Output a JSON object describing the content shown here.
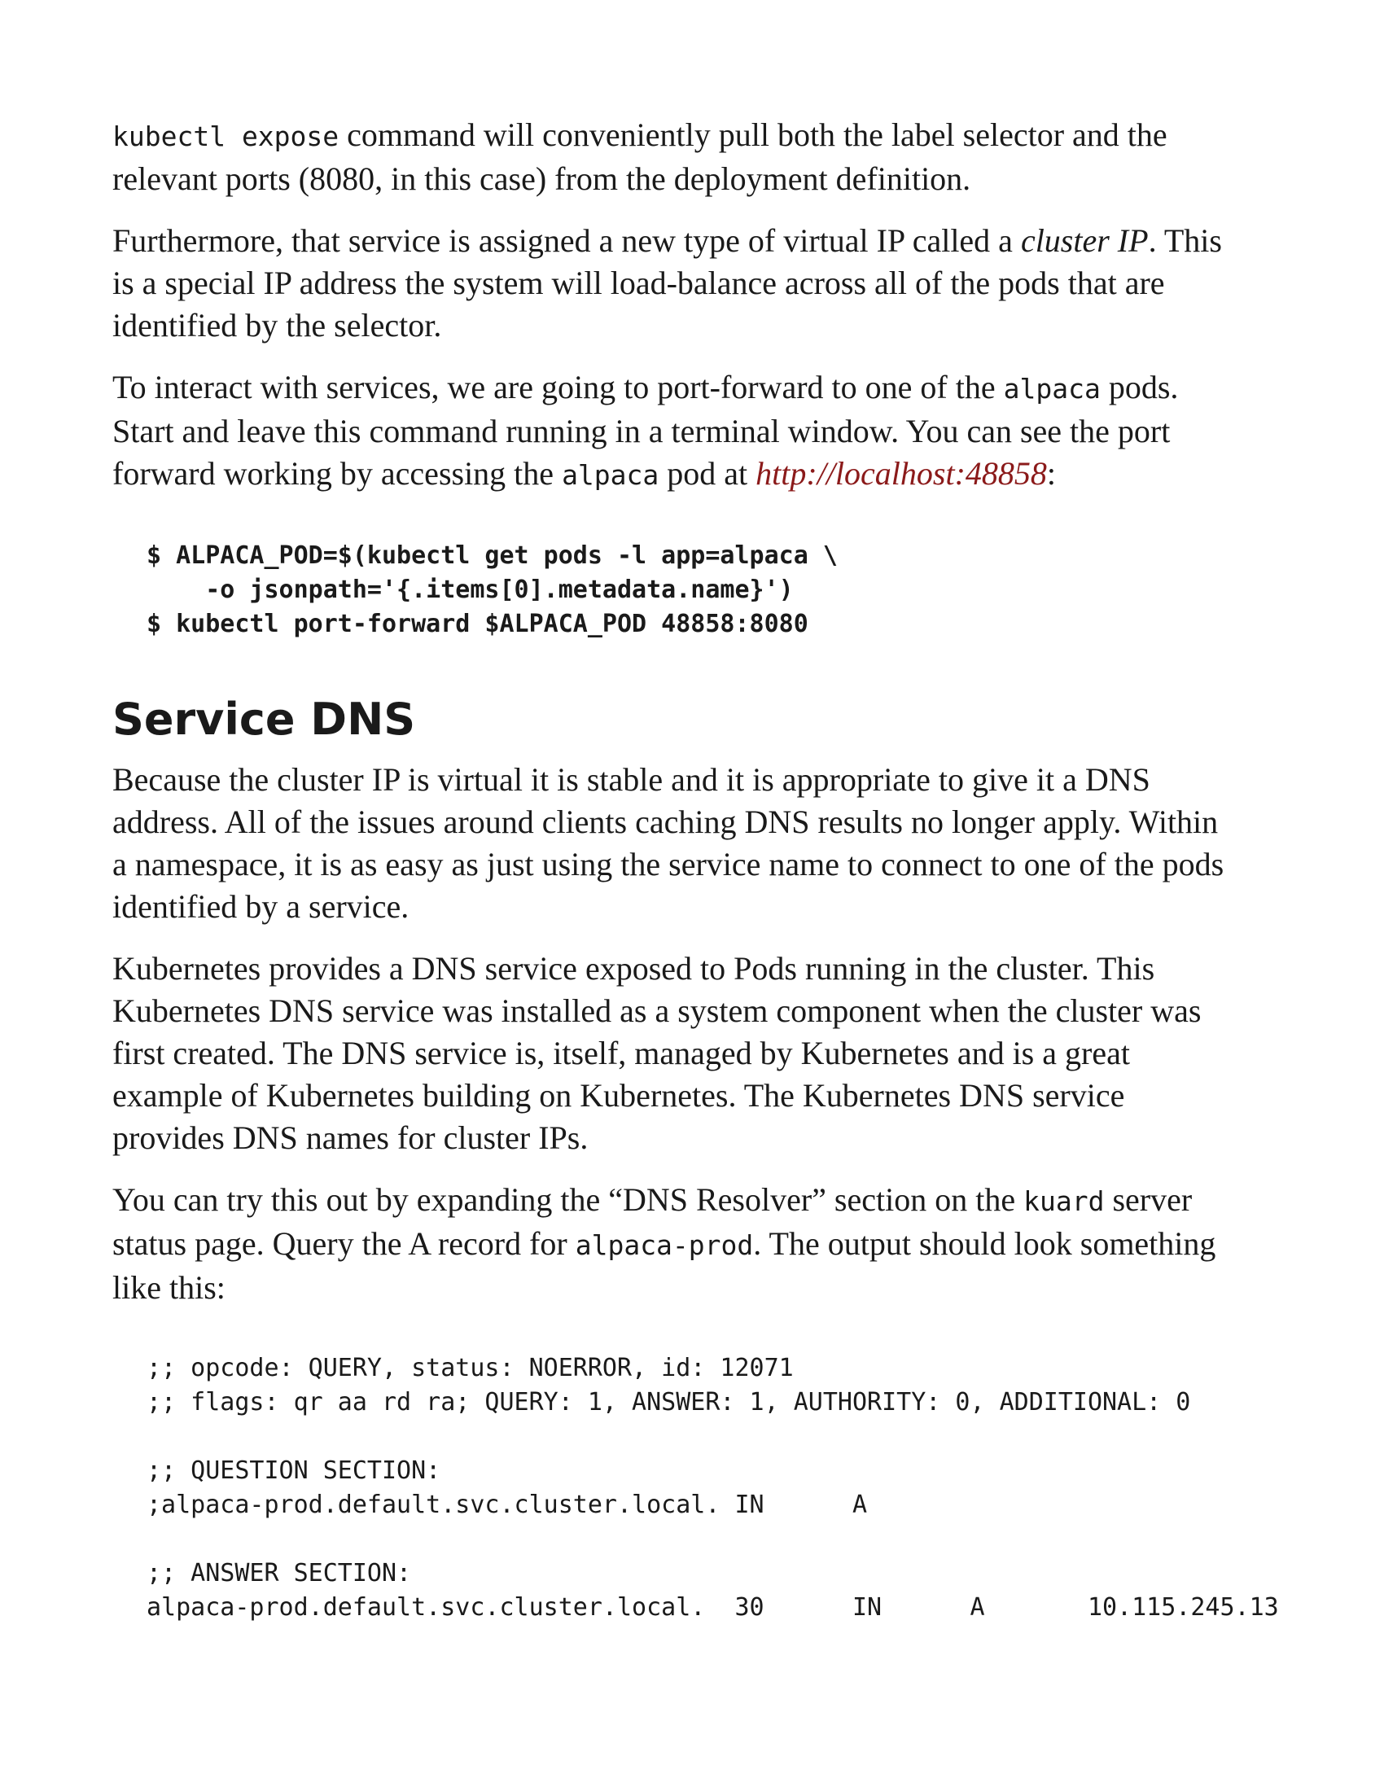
{
  "paragraphs": {
    "p1": {
      "l1_code": "kubectl expose",
      "l1_text": " command will conveniently pull both the label selector and the",
      "l2": "relevant ports (8080, in this case) from the deployment definition."
    },
    "p2": {
      "l1_pre": "Furthermore, that service is assigned a new type of virtual IP called a ",
      "l1_em": "cluster IP",
      "l1_post": ". This",
      "l2": "is a special IP address the system will load-balance across all of the pods that are",
      "l3": "identified by the selector."
    },
    "p3": {
      "l1_pre": "To interact with services, we are going to port-forward to one of the ",
      "l1_code": "alpaca",
      "l1_post": " pods.",
      "l2": "Start and leave this command running in a terminal window. You can see the port",
      "l3_pre": "forward working by accessing the ",
      "l3_code": "alpaca",
      "l3_mid": " pod at ",
      "l3_link": "http://localhost:48858",
      "l3_post": ":"
    }
  },
  "code_block_1": {
    "line1": "$ ALPACA_POD=$(kubectl get pods -l app=alpaca \\",
    "line2": "    -o jsonpath='{.items[0].metadata.name}')",
    "line3": "$ kubectl port-forward $ALPACA_POD 48858:8080"
  },
  "section": {
    "heading": "Service DNS"
  },
  "paragraphs2": {
    "p4": {
      "l1": "Because the cluster IP is virtual it is stable and it is appropriate to give it a DNS",
      "l2": "address. All of the issues around clients caching DNS results no longer apply. Within",
      "l3": "a namespace, it is as easy as just using the service name to connect to one of the pods",
      "l4": "identified by a service."
    },
    "p5": {
      "l1": "Kubernetes provides a DNS service exposed to Pods running in the cluster. This",
      "l2": "Kubernetes DNS service was installed as a system component when the cluster was",
      "l3": "first created. The DNS service is, itself, managed by Kubernetes and is a great",
      "l4": "example of Kubernetes building on Kubernetes. The Kubernetes DNS service",
      "l5": "provides DNS names for cluster IPs."
    },
    "p6": {
      "l1_pre": "You can try this out by expanding the “DNS Resolver” section on the ",
      "l1_code": "kuard",
      "l1_post": " server",
      "l2_pre": "status page. Query the A record for ",
      "l2_code": "alpaca-prod",
      "l2_post": ". The output should look something",
      "l3": "like this:"
    }
  },
  "code_block_2": {
    "line1": ";; opcode: QUERY, status: NOERROR, id: 12071",
    "line2": ";; flags: qr aa rd ra; QUERY: 1, ANSWER: 1, AUTHORITY: 0, ADDITIONAL: 0",
    "line3": "",
    "line4": ";; QUESTION SECTION:",
    "line5": ";alpaca-prod.default.svc.cluster.local. IN      A",
    "line6": "",
    "line7": ";; ANSWER SECTION:",
    "line8": "alpaca-prod.default.svc.cluster.local.  30      IN      A       10.115.245.13"
  }
}
